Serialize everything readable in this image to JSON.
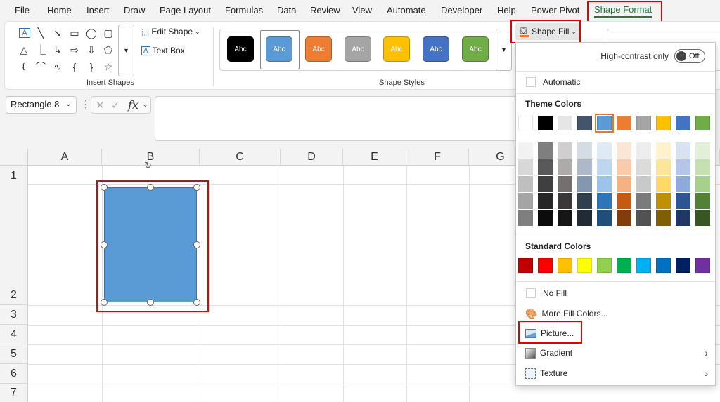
{
  "menu": {
    "tabs": [
      "File",
      "Home",
      "Insert",
      "Draw",
      "Page Layout",
      "Formulas",
      "Data",
      "Review",
      "View",
      "Automate",
      "Developer",
      "Help",
      "Power Pivot",
      "Shape Format"
    ],
    "active": "Shape Format"
  },
  "ribbon": {
    "edit_shape": "Edit Shape",
    "text_box": "Text Box",
    "insert_shapes_label": "Insert Shapes",
    "shape_styles_label": "Shape Styles",
    "style_text": "Abc",
    "style_colors": [
      "#000000",
      "#5b9bd5",
      "#ed7d31",
      "#a5a5a5",
      "#ffc000",
      "#4472c4",
      "#70ad47"
    ],
    "shape_fill": "Shape Fill"
  },
  "formula_bar": {
    "name_box": "Rectangle 8",
    "fx": "fx"
  },
  "grid": {
    "columns": [
      "A",
      "B",
      "C",
      "D",
      "E",
      "F",
      "G"
    ],
    "rows": [
      "1",
      "2",
      "3",
      "4",
      "5",
      "6",
      "7"
    ]
  },
  "shape": {
    "fill": "#5b9bd5"
  },
  "dropdown": {
    "high_contrast": "High-contrast only",
    "toggle": "Off",
    "automatic": "Automatic",
    "theme_colors_title": "Theme Colors",
    "theme_top": [
      "#ffffff",
      "#000000",
      "#e7e6e6",
      "#44546a",
      "#5b9bd5",
      "#ed7d31",
      "#a5a5a5",
      "#ffc000",
      "#4472c4",
      "#70ad47"
    ],
    "theme_shades": [
      [
        "#f2f2f2",
        "#7f7f7f",
        "#d0cece",
        "#d6dce4",
        "#deebf6",
        "#fbe5d5",
        "#ededed",
        "#fff2cc",
        "#d9e2f3",
        "#e2efd9"
      ],
      [
        "#d8d8d8",
        "#595959",
        "#aeaaaa",
        "#adb9ca",
        "#bdd7ee",
        "#f7cbac",
        "#dbdbdb",
        "#fee599",
        "#b4c6e7",
        "#c5e0b3"
      ],
      [
        "#bfbfbf",
        "#3f3f3f",
        "#757070",
        "#8496b0",
        "#9dc3e6",
        "#f4b183",
        "#c9c9c9",
        "#ffd965",
        "#8eaadb",
        "#a8d08d"
      ],
      [
        "#a5a5a5",
        "#262626",
        "#3a3838",
        "#323f4f",
        "#2e75b5",
        "#c55a11",
        "#7b7b7b",
        "#bf9000",
        "#2f5496",
        "#538135"
      ],
      [
        "#7f7f7f",
        "#0c0c0c",
        "#171616",
        "#222a35",
        "#1f4e79",
        "#833c0b",
        "#525252",
        "#7f6000",
        "#1f3864",
        "#375623"
      ]
    ],
    "standard_colors_title": "Standard Colors",
    "standard": [
      "#c00000",
      "#ff0000",
      "#ffc000",
      "#ffff00",
      "#92d050",
      "#00b050",
      "#00b0f0",
      "#0070c0",
      "#002060",
      "#7030a0"
    ],
    "no_fill": "No Fill",
    "more_fill_colors": "More Fill Colors...",
    "picture": "Picture...",
    "gradient": "Gradient",
    "texture": "Texture"
  }
}
